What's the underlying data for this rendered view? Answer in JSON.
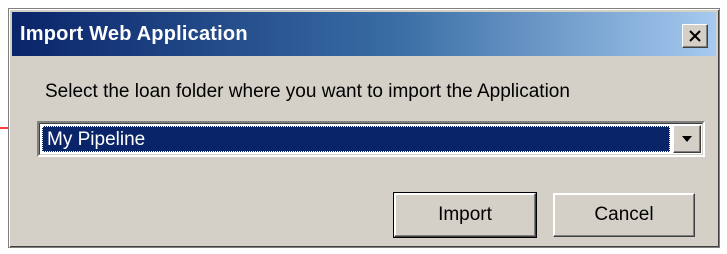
{
  "dialog": {
    "title": "Import Web Application",
    "close_icon": "close-icon"
  },
  "prompt": "Select the loan folder where you want to import the Application",
  "folder_select": {
    "value": "My Pipeline",
    "dropdown_icon": "chevron-down-icon"
  },
  "buttons": {
    "import": "Import",
    "cancel": "Cancel"
  },
  "annotation": {
    "arrow_icon": "right-arrow-icon",
    "color": "#ff0000"
  },
  "colors": {
    "titlebar_start": "#0a246a",
    "titlebar_end": "#a6caf0",
    "selection": "#0a246a",
    "face": "#d4d0c8"
  }
}
